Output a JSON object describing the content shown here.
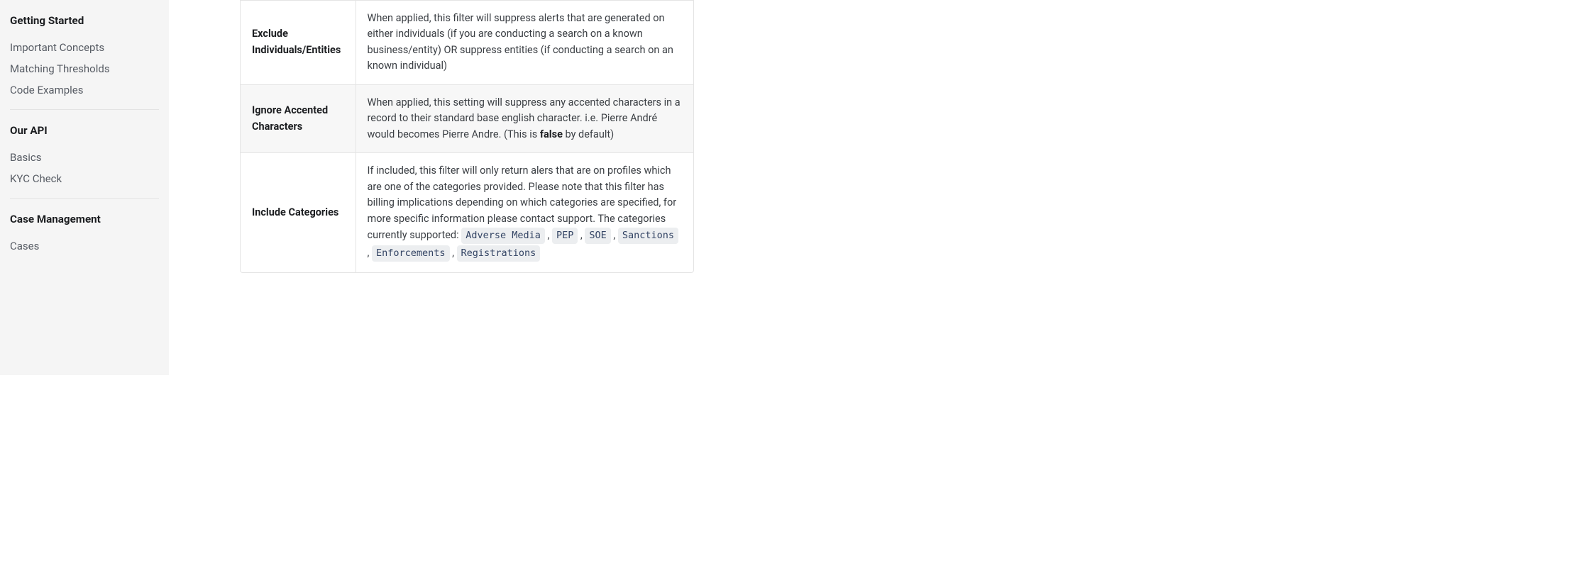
{
  "sidebar": {
    "groups": [
      {
        "heading": "Getting Started",
        "links": [
          "Important Concepts",
          "Matching Thresholds",
          "Code Examples"
        ]
      },
      {
        "heading": "Our API",
        "links": [
          "Basics",
          "KYC Check"
        ]
      },
      {
        "heading": "Case Management",
        "links": [
          "Cases"
        ]
      }
    ]
  },
  "table": {
    "rows": [
      {
        "name": "Exclude Individuals/Entities",
        "desc_pre": "When applied, this filter will suppress alerts that are generated on either individuals (if you are conducting a search on a known business/entity) OR suppress entities (if conducting a search on an known individual)",
        "bold": "",
        "desc_post": "",
        "categories": []
      },
      {
        "name": "Ignore Accented Characters",
        "desc_pre": "When applied, this setting will suppress any accented characters in a record to their standard base english character. i.e. Pierre André would becomes Pierre Andre. (This is ",
        "bold": "false",
        "desc_post": " by default)",
        "categories": []
      },
      {
        "name": "Include Categories",
        "desc_pre": "If included, this filter will only return alers that are on profiles which are one of the categories provided. Please note that this filter has billing implications depending on which categories are specified, for more specific information please contact support. The categories currently supported: ",
        "bold": "",
        "desc_post": "",
        "categories": [
          "Adverse Media",
          "PEP",
          "SOE",
          "Sanctions",
          "Enforcements",
          "Registrations"
        ]
      }
    ]
  }
}
